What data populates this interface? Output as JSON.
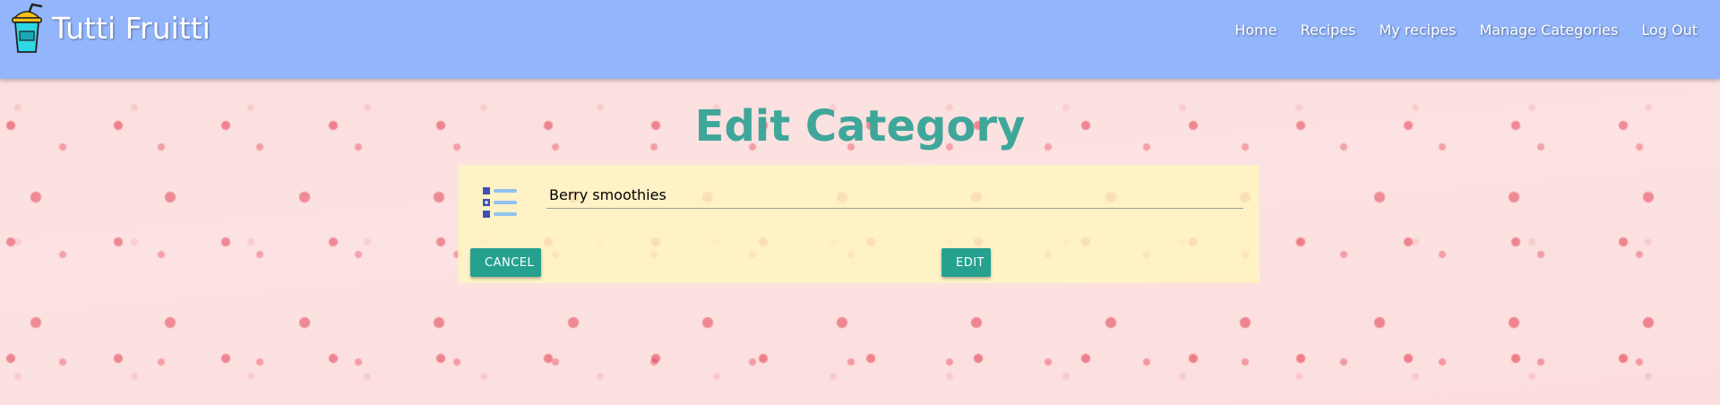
{
  "brand": {
    "name": "Tutti Fruitti",
    "logo_icon": "smoothie-cup-icon"
  },
  "nav": {
    "items": [
      {
        "label": "Home"
      },
      {
        "label": "Recipes"
      },
      {
        "label": "My recipes"
      },
      {
        "label": "Manage Categories"
      },
      {
        "label": "Log Out"
      }
    ]
  },
  "page": {
    "title": "Edit Category"
  },
  "form": {
    "field_icon": "list-icon",
    "category_name": "Berry smoothies",
    "cancel_label": "Cancel",
    "cancel_icon": "close-circle-icon",
    "edit_label": "Edit",
    "edit_icon": "edit-icon"
  },
  "colors": {
    "navbar": "#92b5fc",
    "title": "#3fa69a",
    "button": "#26a190",
    "card": "#fff6be",
    "background": "#fcdede"
  }
}
